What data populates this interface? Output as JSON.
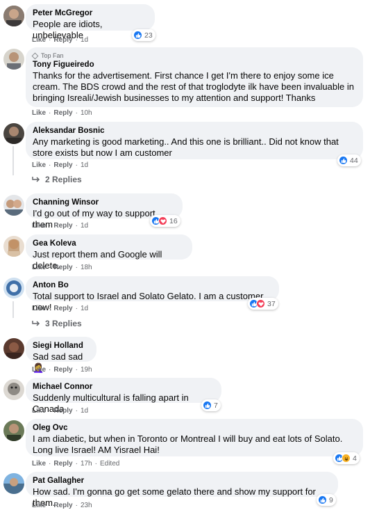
{
  "comments": [
    {
      "author": "Peter McGregor",
      "text": "People are idiots, unbelievable",
      "like": "Like",
      "reply": "Reply",
      "time": "1d",
      "reactions": "23"
    },
    {
      "author": "Tony Figueiredo",
      "badge": "Top Fan",
      "text": "Thanks for the advertisement. First chance I get I'm there to enjoy some ice cream. The BDS crowd and the rest of that troglodyte ilk have been invaluable in bringing Isreali/Jewish businesses to my attention and support! Thanks",
      "like": "Like",
      "reply": "Reply",
      "time": "10h"
    },
    {
      "author": "Aleksandar Bosnic",
      "text": "Any marketing is good marketing.. And this one is brilliant.. Did not know that store exists but now I am customer",
      "like": "Like",
      "reply": "Reply",
      "time": "1d",
      "reactions": "44",
      "replies": "2 Replies"
    },
    {
      "author": "Channing Winsor",
      "text": "I'd go out of my way to support them",
      "like": "Like",
      "reply": "Reply",
      "time": "1d",
      "reactions": "16"
    },
    {
      "author": "Gea Koleva",
      "text": "Just report them and Google will delete.",
      "like": "Like",
      "reply": "Reply",
      "time": "18h"
    },
    {
      "author": "Anton Bo",
      "text": "Total support to Israel and Solato Gelato. I am a customer now!",
      "like": "Like",
      "reply": "Reply",
      "time": "1d",
      "reactions": "37",
      "replies": "3 Replies"
    },
    {
      "author": "Siegi Holland",
      "text": "Sad sad sad 🤦‍♀️",
      "like": "Like",
      "reply": "Reply",
      "time": "19h"
    },
    {
      "author": "Michael Connor",
      "text": "Suddenly multicultural is falling apart in Canada",
      "like": "Like",
      "reply": "Reply",
      "time": "1d",
      "reactions": "7"
    },
    {
      "author": "Oleg Ovc",
      "text": "I am diabetic, but when in Toronto or Montreal I will buy and eat lots of Solato. Long live Israel! AM Yisrael Hai!",
      "like": "Like",
      "reply": "Reply",
      "time": "17h",
      "edited": "Edited",
      "reactions": "4"
    },
    {
      "author": "Pat Gallagher",
      "text": "How sad. I'm gonna go get some gelato there and show my support for them.",
      "like": "Like",
      "reply": "Reply",
      "time": "23h",
      "reactions": "9"
    }
  ],
  "separator": "·",
  "colors": {
    "like_blue": "#1877f2",
    "love_red": "#f33e58",
    "haha_yellow": "#f7b125",
    "bubble": "#f0f2f5",
    "meta_gray": "#65676b"
  }
}
